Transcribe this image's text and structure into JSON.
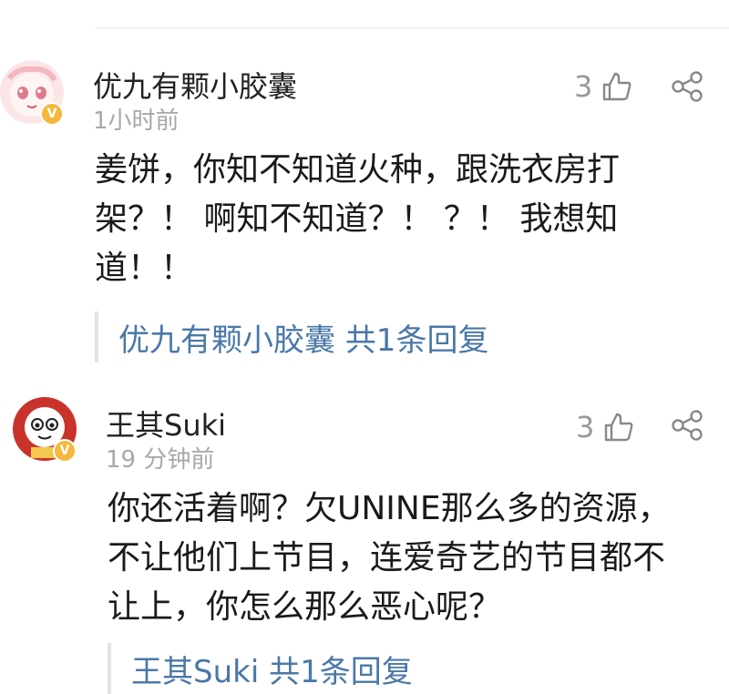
{
  "comments": [
    {
      "username": "优九有颗小胶囊",
      "time": "1小时前",
      "likes": "3",
      "body_lines": [
        "姜饼，你知不知道火种，跟洗衣房打",
        "架？！ 啊知不知道？！ ？！ 我想知",
        "道！！"
      ],
      "reply_author": "优九有颗小胶囊",
      "reply_count": "共1条回复"
    },
    {
      "username": "王其Suki",
      "time": "19 分钟前",
      "likes": "3",
      "body_lines": [
        "你还活着啊？欠UNINE那么多的资源，",
        "不让他们上节目，连爱奇艺的节目都不",
        "让上，你怎么那么恶心呢？"
      ],
      "reply_author": "王其Suki",
      "reply_count": "共1条回复"
    }
  ],
  "badge": "V",
  "colors": {
    "reply_link": "#4a78a8",
    "badge": "#f5b83d",
    "muted": "#999999"
  }
}
